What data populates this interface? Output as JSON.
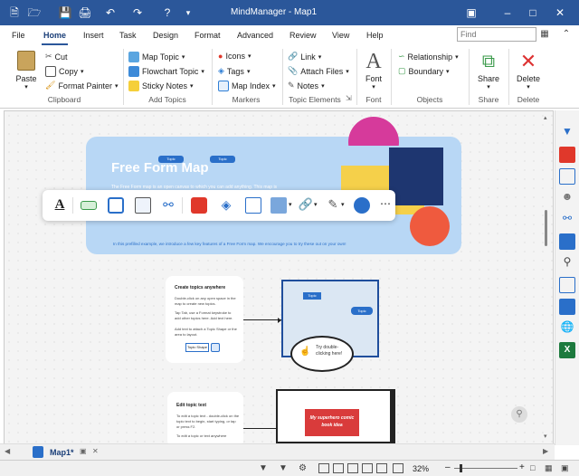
{
  "app": {
    "title": "MindManager - Map1"
  },
  "menu": {
    "tabs": [
      "File",
      "Home",
      "Insert",
      "Task",
      "Design",
      "Format",
      "Advanced",
      "Review",
      "View",
      "Help"
    ],
    "active": "Home"
  },
  "search": {
    "placeholder": "Find"
  },
  "ribbon": {
    "clipboard": {
      "paste": "Paste",
      "cut": "Cut",
      "copy": "Copy",
      "format_painter": "Format Painter",
      "label": "Clipboard"
    },
    "add_topics": {
      "map_topic": "Map Topic",
      "flowchart_topic": "Flowchart Topic",
      "sticky_notes": "Sticky Notes",
      "label": "Add Topics"
    },
    "markers": {
      "icons": "Icons",
      "tags": "Tags",
      "map_index": "Map Index",
      "label": "Markers"
    },
    "topic_elements": {
      "link": "Link",
      "attach_files": "Attach Files",
      "notes": "Notes",
      "label": "Topic Elements"
    },
    "font": {
      "font": "Font",
      "label": "Font"
    },
    "objects": {
      "relationship": "Relationship",
      "boundary": "Boundary",
      "label": "Objects"
    },
    "share": {
      "share": "Share",
      "label": "Share"
    },
    "delete": {
      "delete": "Delete",
      "label": "Delete"
    }
  },
  "canvas": {
    "banner_title": "Free Form Map",
    "banner_sub": "The Free Form map is an open canvas to which you can add anything. This map is",
    "topic_chip_1": "Topic",
    "topic_chip_2": "Topic",
    "prefilled": "In this prefilled example, we introduce a few key features of a Free Form map. We encourage you to try these out on your own!",
    "card1_title": "Create topics anywhere",
    "card1_text1": "Double-click on any open space in the map to create new topics.",
    "card1_text2": "Tap Tab, use a Format keystroke to add other topics here. Add text here.",
    "card1_text3": "Add text to attach a Topic Shape or the area to layout.",
    "card1_chip": "Topic Shape",
    "frame_topic1": "Topic",
    "frame_topic2": "Topic",
    "bubble_text": "Try double-clicking here!",
    "card2_title": "Edit topic text",
    "card2_text1": "To edit a topic text - double-click on the topic text to begin, start typing, or tap or press F2.",
    "card2_text2": "To edit a topic or text anywhere",
    "comic_text": "My superhero comic book idea"
  },
  "doc_tab": {
    "name": "Map1*"
  },
  "status": {
    "zoom": "32%"
  },
  "colors": {
    "titlebar": "#2b579a",
    "banner": "#b3d4f5",
    "banner_title": "#ffffff",
    "accent_pink": "#d63a9b",
    "accent_yellow": "#f5d04a",
    "accent_navy": "#1e3670",
    "accent_red": "#ef5a3e",
    "frame_blue": "#1f4e9c"
  }
}
